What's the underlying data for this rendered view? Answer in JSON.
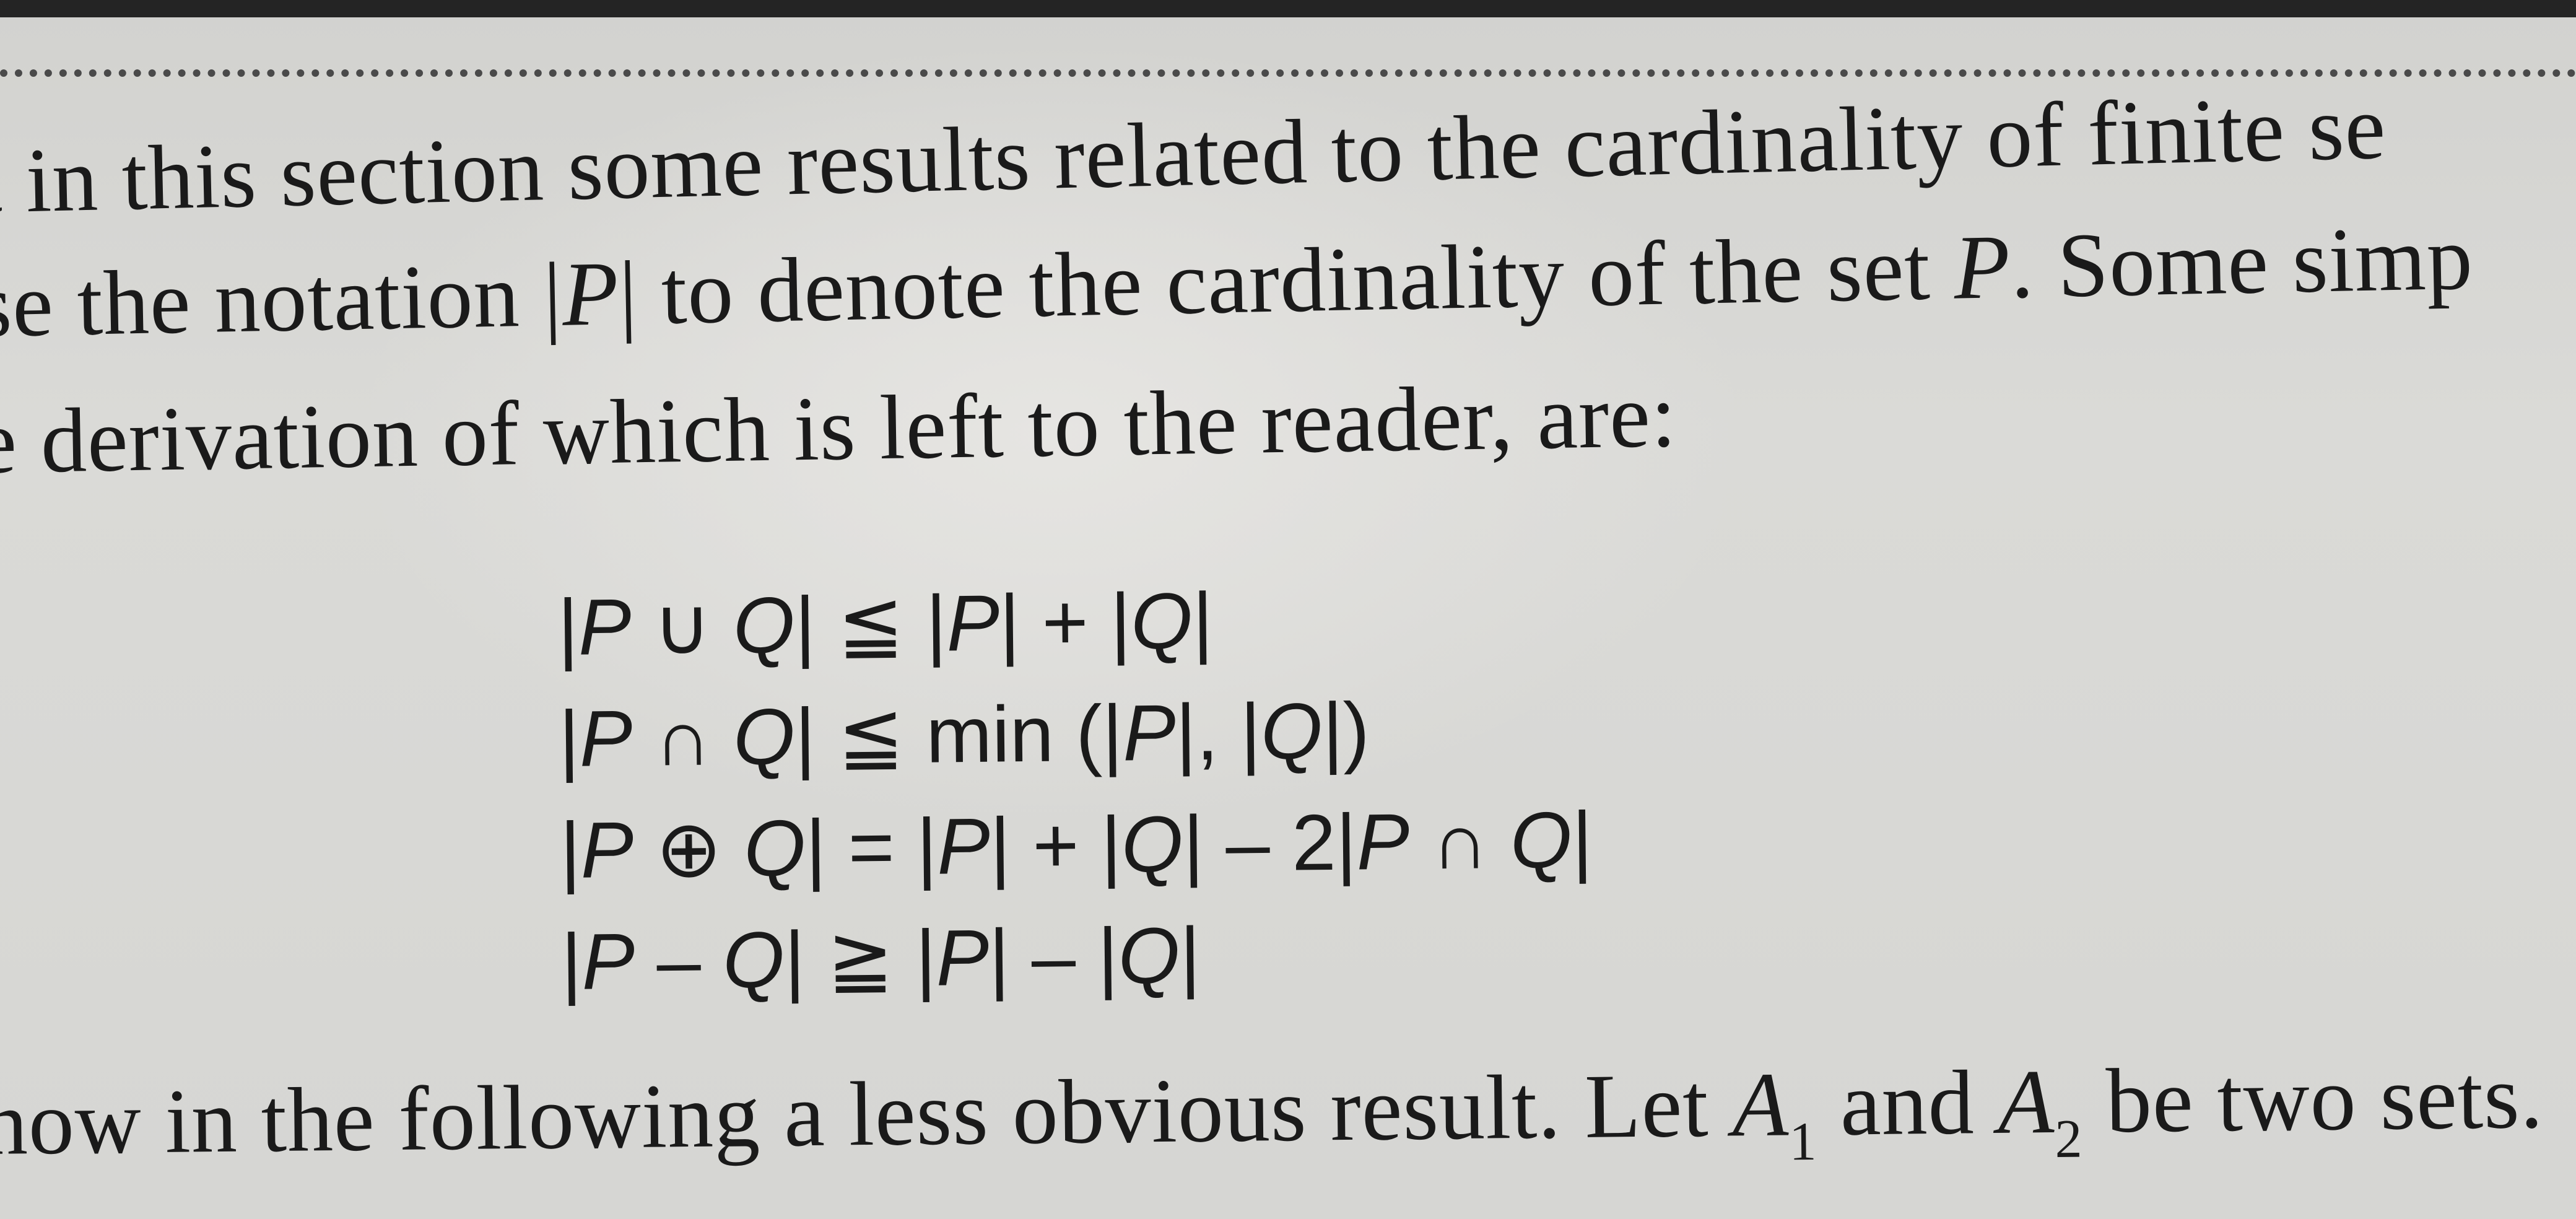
{
  "text": {
    "line1": "t in this section some results related to the cardinality of finite se",
    "line2_a": "se the notation |",
    "line2_var": "P",
    "line2_b": "| to denote the cardinality of the set ",
    "line2_var2": "P",
    "line2_c": ". Some simp",
    "line3": "e derivation of which is left to the reader, are:",
    "line5_a": "now in the following a less obvious result. Let ",
    "line5_var1": "A",
    "line5_sub1": "1",
    "line5_b": " and ",
    "line5_var2": "A",
    "line5_sub2": "2",
    "line5_c": " be two sets."
  },
  "formulas": [
    "|P ∪ Q| ≦ |P| + |Q|",
    "|P ∩ Q| ≦ min (|P|, |Q|)",
    "|P ⊕ Q| = |P| + |Q| – 2|P ∩ Q|",
    "|P – Q| ≧ |P| – |Q|"
  ]
}
